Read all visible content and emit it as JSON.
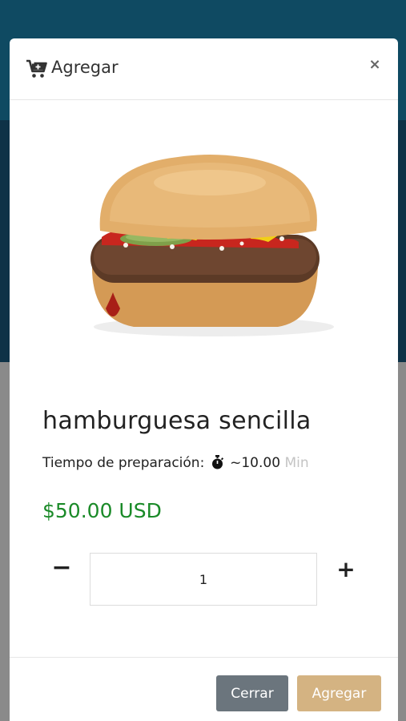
{
  "modal": {
    "title": "Agregar",
    "close_symbol": "×"
  },
  "product": {
    "name": "hamburguesa sencilla",
    "prep_label": "Tiempo de preparación:",
    "prep_time": "~10.00",
    "prep_unit": "Min",
    "price": "$50.00 USD"
  },
  "quantity": {
    "minus": "−",
    "plus": "+",
    "value": "1"
  },
  "footer": {
    "close_label": "Cerrar",
    "add_label": "Agregar"
  },
  "icons": {
    "cart": "cart-plus-icon",
    "timer": "stopwatch-icon",
    "close": "close-icon"
  },
  "colors": {
    "header_bg": "#0f4a62",
    "overlay_dark": "#0e3247",
    "price": "#1a8a28",
    "button_close": "#6b757d",
    "button_add": "#d4b382"
  }
}
